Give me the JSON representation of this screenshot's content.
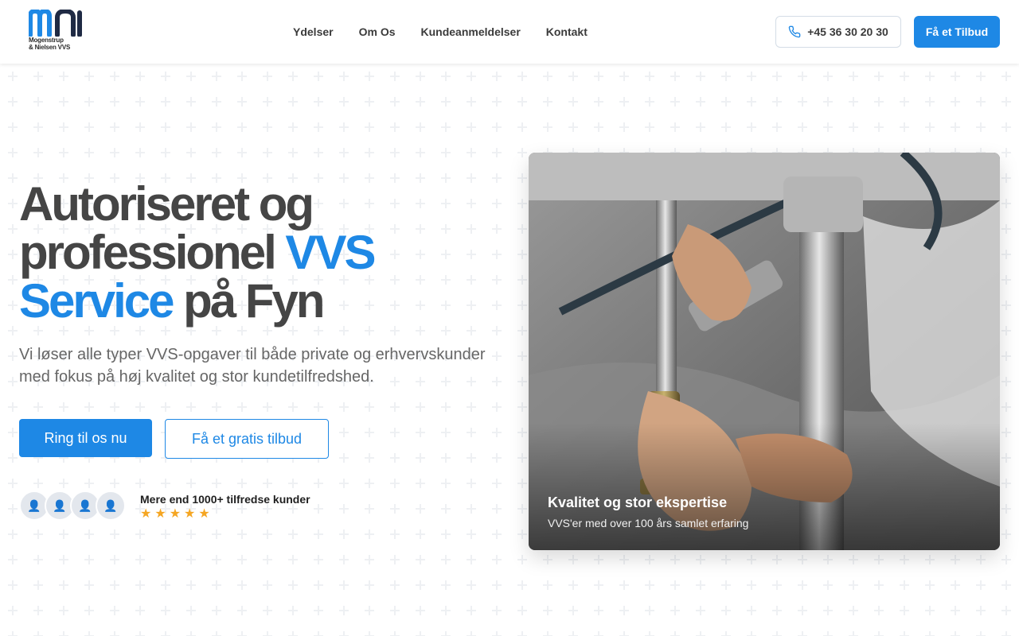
{
  "header": {
    "logo_text": "Mogenstrup\n& Nielsen VVS",
    "nav": [
      "Ydelser",
      "Om Os",
      "Kundeanmeldelser",
      "Kontakt"
    ],
    "phone": "+45 36 30 20 30",
    "quote_button": "Få et Tilbud"
  },
  "hero": {
    "title_line1": "Autoriseret og",
    "title_line2_a": "professionel ",
    "title_line2_b": "VVS",
    "title_line3_a": "Service",
    "title_line3_b": " på Fyn",
    "subtitle": "Vi løser alle typer VVS-opgaver til både private og erhvervskunder med fokus på høj kvalitet og stor kundetilfredshed.",
    "cta_primary": "Ring til os nu",
    "cta_secondary": "Få et gratis tilbud",
    "customers_text": "Mere end 1000+ tilfredse kunder",
    "rating": 5,
    "image_caption_title": "Kvalitet og stor ekspertise",
    "image_caption_sub": "VVS'er med over 100 års samlet erfaring"
  },
  "colors": {
    "accent": "#1e88e5",
    "heading": "#454545",
    "star": "#f5a623"
  },
  "icons": {
    "phone": "phone-icon",
    "avatar": "user-icon",
    "star": "star-icon"
  }
}
